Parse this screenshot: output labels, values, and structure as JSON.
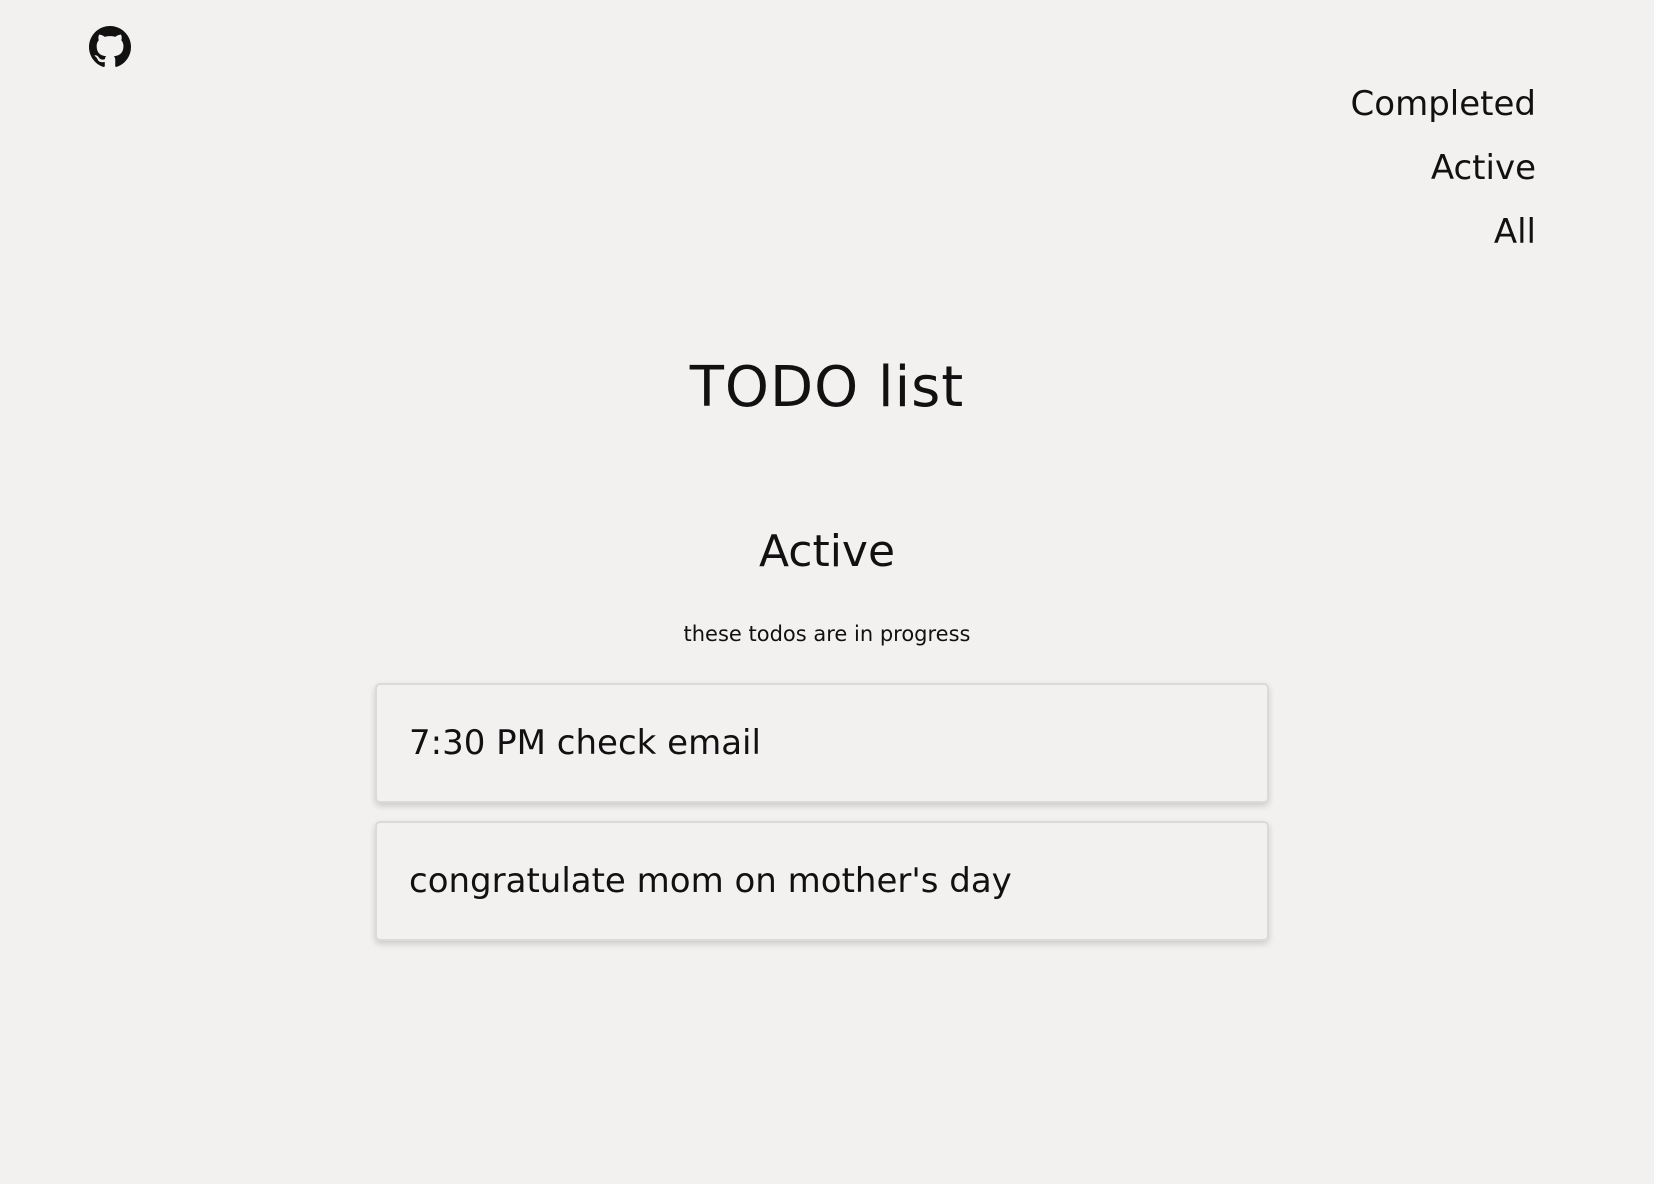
{
  "header": {
    "github_icon": "github-icon"
  },
  "filters": {
    "items": [
      {
        "label": "Completed"
      },
      {
        "label": "Active"
      },
      {
        "label": "All"
      }
    ]
  },
  "main": {
    "title": "TODO list",
    "section_title": "Active",
    "section_subtitle": "these todos are in progress",
    "todos": [
      {
        "text": "7:30 PM check email"
      },
      {
        "text": "congratulate mom on mother's day"
      }
    ]
  },
  "colors": {
    "background": "#f3f1f0",
    "text": "#111111",
    "card_border": "#dcd9d9"
  }
}
